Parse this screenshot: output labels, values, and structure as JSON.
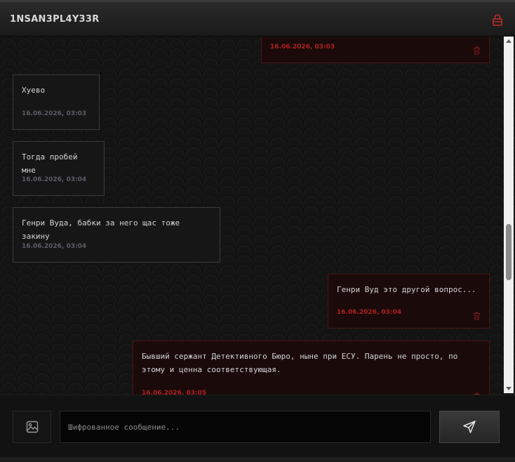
{
  "header": {
    "title": "1NSAN3PL4Y33R",
    "lock_icon": "lock-icon",
    "accent": "#c0282a"
  },
  "messages": [
    {
      "direction": "out",
      "text": "",
      "time": "16.06.2026, 03:03"
    },
    {
      "direction": "in",
      "text": "Хуево",
      "time": "16.06.2026, 03:03"
    },
    {
      "direction": "in",
      "text": "Тогда пробей мне",
      "time": "16.06.2026, 03:04"
    },
    {
      "direction": "in",
      "text": "Генри Вуда, бабки за него щас тоже закину",
      "time": "16.06.2026, 03:04"
    },
    {
      "direction": "out",
      "text": "Генри Вуд это другой вопрос...",
      "time": "16.06.2026, 03:04"
    },
    {
      "direction": "out",
      "text": "Бывший сержант Детективного Бюро, ныне при ЕСУ. Парень не просто, по этому и ценна соответствующая.",
      "time": "16.06.2026, 03:05"
    }
  ],
  "composer": {
    "placeholder": "Шифрованное сообщение...",
    "value": "",
    "attach_icon": "image-icon",
    "send_icon": "send-icon"
  }
}
